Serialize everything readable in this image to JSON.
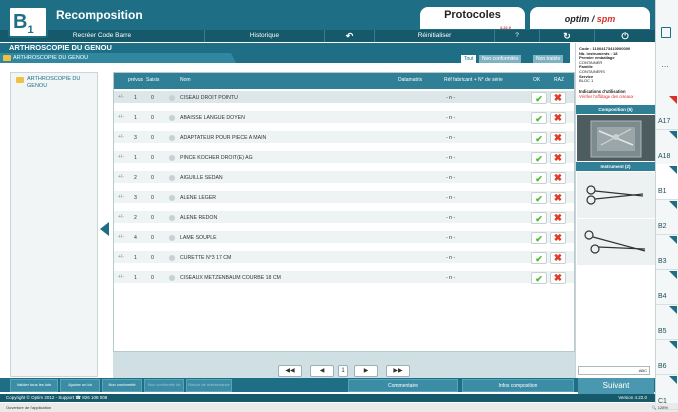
{
  "header": {
    "badge_letter": "B",
    "badge_sub": "1",
    "title": "Recomposition",
    "protocoles": "Protocoles",
    "protocoles_version": "4.22.0",
    "brand_optim": "optim",
    "brand_spm": "spm"
  },
  "menu": {
    "recreer": "Recréer Code Barre",
    "historique": "Historique",
    "reinitialiser": "Réinitialiser",
    "help": "?"
  },
  "page_title": "ARTHROSCOPIE DU GENOU",
  "folder_label": "ARTHROSCOPIE DU GENOU",
  "filters": {
    "tout": "Tout",
    "non_conformites": "Non conformités",
    "non_traites": "Non traités"
  },
  "tree": {
    "item": "ARTHROSCOPIE DU GENOU"
  },
  "table": {
    "headers": {
      "prevus": "prévus",
      "saisis": "Saisis",
      "nom": "Nom",
      "datamatrix": "Datamatrix",
      "ref": "Réf fabricant + N° de série",
      "ok": "OK",
      "raz": "RAZ"
    },
    "rows": [
      {
        "expand": "+/-",
        "prevus": "1",
        "saisis": "0",
        "nom": "CISEAU DROIT POINTU",
        "ref": "- n -"
      },
      {
        "expand": "+/-",
        "prevus": "1",
        "saisis": "0",
        "nom": "ABAISSE LANGUE DOYEN",
        "ref": "- n -"
      },
      {
        "expand": "+/-",
        "prevus": "3",
        "saisis": "0",
        "nom": "ADAPTATEUR POUR PIECE A MAIN",
        "ref": "- n -"
      },
      {
        "expand": "+/-",
        "prevus": "1",
        "saisis": "0",
        "nom": "PINCE KOCHER DROIT(E) AG",
        "ref": "- n -"
      },
      {
        "expand": "+/-",
        "prevus": "2",
        "saisis": "0",
        "nom": "AIGUILLE SEDAN",
        "ref": "- n -"
      },
      {
        "expand": "+/-",
        "prevus": "3",
        "saisis": "0",
        "nom": "ALENE LEGER",
        "ref": "- n -"
      },
      {
        "expand": "+/-",
        "prevus": "2",
        "saisis": "0",
        "nom": "ALENE REDON",
        "ref": "- n -"
      },
      {
        "expand": "+/-",
        "prevus": "4",
        "saisis": "0",
        "nom": "LAME SOUPLE",
        "ref": "- n -"
      },
      {
        "expand": "+/-",
        "prevus": "1",
        "saisis": "0",
        "nom": "CURETTE N°3 17 CM",
        "ref": "- n -"
      },
      {
        "expand": "+/-",
        "prevus": "1",
        "saisis": "0",
        "nom": "CISEAUX METZENBAUM COURBE 18 CM",
        "ref": "- n -"
      }
    ],
    "ok_icon": "check-icon",
    "raz_icon": "cross-icon",
    "ok_glyph": "✔",
    "raz_glyph": "✖"
  },
  "pager": {
    "first": "◀◀",
    "prev": "◀",
    "page": "1",
    "next": "▶",
    "last": "▶▶"
  },
  "footer": {
    "valider_tous": "Valider tous les lots",
    "ajouter_lot": "Ajouter un lot",
    "non_conformite": "Non conformité",
    "non_conformite_lot": "Non conformité lot",
    "retour_maintenance": "Retour de maintenance",
    "commentaire": "Commentaire",
    "infos_composition": "Infos composition",
    "suivant": "Suivant",
    "copyright": "Copyright © Optim 2012 - Support ☎ 826 108 008",
    "version": "Version 4.22.0",
    "status": "Ouverture de l'application",
    "zoom": "🔍 128%"
  },
  "info": {
    "code": "Code : 11004173410000000",
    "nb_instruments": "Nb. instruments : 18",
    "premier_emballage_label": "Premier emballage",
    "premier_emballage": "CONTAINER",
    "famille_label": "Famille",
    "famille": "CONTAINERS",
    "service_label": "Service",
    "service": "BLOC 1",
    "indications_label": "Indications d'utilisation",
    "indications": "Vérifier l'affûtage des ciseaux",
    "composition": "Composition (5)",
    "instrument": "Instrument (2)",
    "search": "ABC"
  },
  "sidetabs": [
    "A17",
    "A18",
    "B1",
    "B2",
    "B3",
    "B4",
    "B5",
    "B6",
    "C1"
  ],
  "colors": {
    "primary": "#1e6f85",
    "ok": "#4cba2e",
    "raz": "#e03c2b"
  }
}
